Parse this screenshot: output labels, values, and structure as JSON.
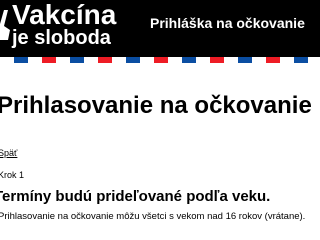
{
  "header": {
    "logo_title": "Vakcína",
    "logo_subtitle": "je sloboda",
    "logo_icon": "victory-hand-icon",
    "nav_link": "Prihláška na očkovanie"
  },
  "colors": {
    "header_bg": "#000000",
    "stripe_blue": "#0b4ea2",
    "stripe_red": "#ee1c25"
  },
  "main": {
    "title": "Prihlasovanie na očkovanie",
    "back_link": "Späť",
    "step": "Krok 1",
    "notice_heading": "Termíny budú prideľované podľa veku.",
    "notice_text": "Prihlasovanie na očkovanie môžu všetci s vekom nad 16 rokov (vrátane)."
  }
}
